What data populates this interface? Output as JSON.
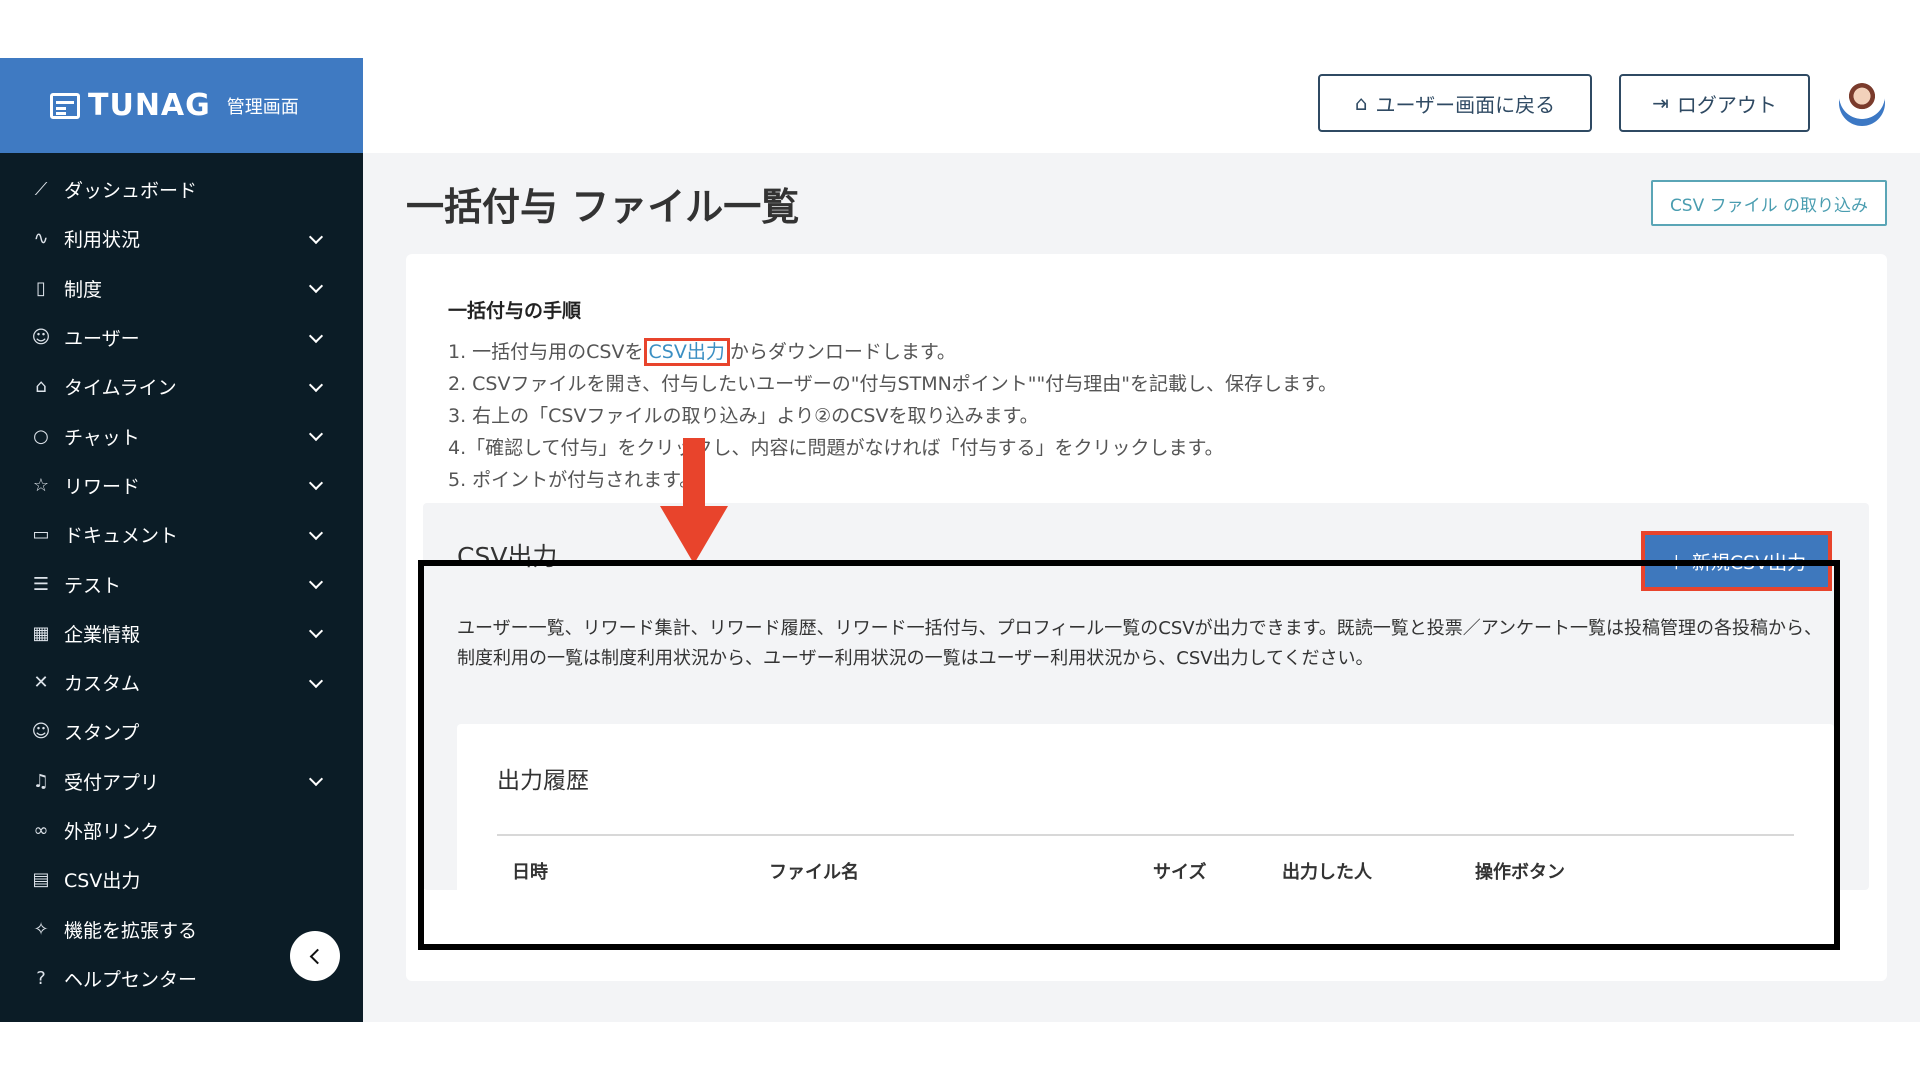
{
  "brand": {
    "name": "TUNAG",
    "subtitle": "管理画面"
  },
  "sidebar": {
    "items": [
      {
        "label": "ダッシュボード",
        "icon": "chart-line-icon",
        "expandable": false
      },
      {
        "label": "利用状況",
        "icon": "activity-icon",
        "expandable": true
      },
      {
        "label": "制度",
        "icon": "book-icon",
        "expandable": true
      },
      {
        "label": "ユーザー",
        "icon": "users-icon",
        "expandable": true
      },
      {
        "label": "タイムライン",
        "icon": "home-icon",
        "expandable": true
      },
      {
        "label": "チャット",
        "icon": "chat-bubble-icon",
        "expandable": true
      },
      {
        "label": "リワード",
        "icon": "star-icon",
        "expandable": true
      },
      {
        "label": "ドキュメント",
        "icon": "folder-icon",
        "expandable": true
      },
      {
        "label": "テスト",
        "icon": "checklist-icon",
        "expandable": true
      },
      {
        "label": "企業情報",
        "icon": "building-icon",
        "expandable": true
      },
      {
        "label": "カスタム",
        "icon": "tools-icon",
        "expandable": true
      },
      {
        "label": "スタンプ",
        "icon": "smiley-icon",
        "expandable": false
      },
      {
        "label": "受付アプリ",
        "icon": "bell-icon",
        "expandable": true
      },
      {
        "label": "外部リンク",
        "icon": "link-icon",
        "expandable": false
      },
      {
        "label": "CSV出力",
        "icon": "table-icon",
        "expandable": false
      },
      {
        "label": "機能を拡張する",
        "icon": "sparkle-star-icon",
        "expandable": false
      },
      {
        "label": "ヘルプセンター",
        "icon": "question-icon",
        "expandable": false
      }
    ]
  },
  "header": {
    "back_label": "ユーザー画面に戻る",
    "logout_label": "ログアウト"
  },
  "page": {
    "title": "一括付与 ファイル一覧",
    "import_button": "CSV ファイル の取り込み"
  },
  "steps": {
    "title": "一括付与の手順",
    "step1_before": "1. 一括付与用のCSVを",
    "step1_link": "CSV出力",
    "step1_after": "からダウンロードします。",
    "step2": "2. CSVファイルを開き、付与したいユーザーの\"付与STMNポイント\"\"付与理由\"を記載し、保存します。",
    "step3": "3. 右上の「CSVファイルの取り込み」より②のCSVを取り込みます。",
    "step4": "4.「確認して付与」をクリックし、内容に問題がなければ「付与する」をクリックします。",
    "step5": "5. ポイントが付与されます。"
  },
  "csv_export": {
    "title": "CSV出力",
    "new_button": "＋ 新規CSV出力",
    "description": "ユーザー一覧、リワード集計、リワード履歴、リワード一括付与、プロフィール一覧のCSVが出力できます。既読一覧と投票／アンケート一覧は投稿管理の各投稿から、制度利用の一覧は制度利用状況から、ユーザー利用状況の一覧はユーザー利用状況から、CSV出力してください。",
    "history": {
      "title": "出力履歴",
      "columns": [
        "日時",
        "ファイル名",
        "サイズ",
        "出力した人",
        "操作ボタン"
      ]
    }
  },
  "colors": {
    "sidebar_bg": "#0b1c26",
    "brand_bg": "#3f7ac2",
    "primary_button": "#3e78bd",
    "annotation_red": "#e8442c",
    "link": "#3b8fc3"
  }
}
